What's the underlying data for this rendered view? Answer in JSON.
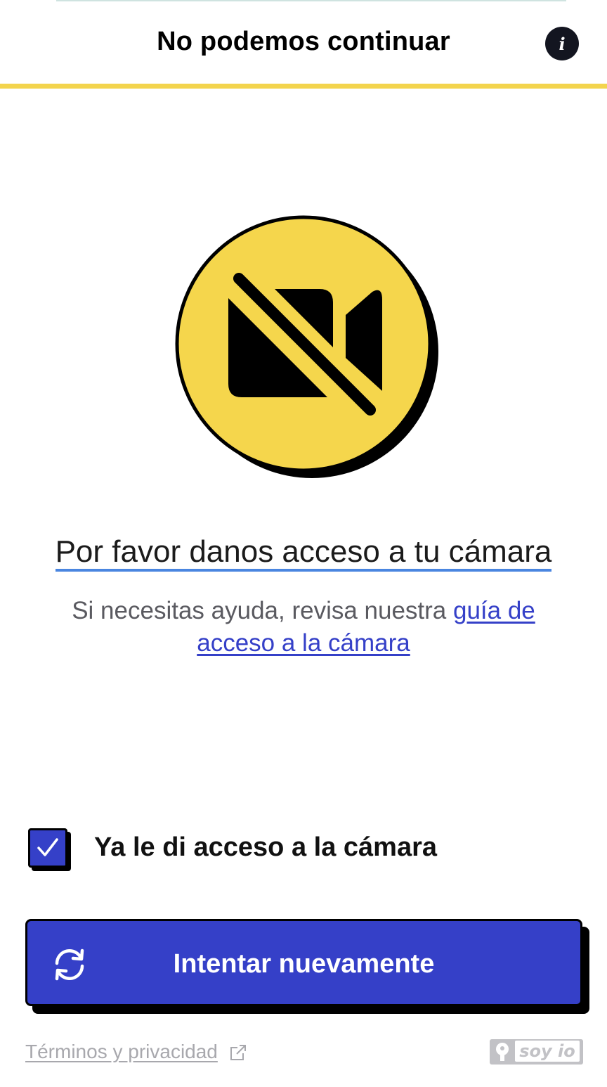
{
  "header": {
    "title": "No podemos continuar",
    "info_icon": "info-icon",
    "accent_color": "#f3d44d"
  },
  "illustration": {
    "icon": "camera-off-icon",
    "circle_color": "#f5d64c"
  },
  "main": {
    "title": "Por favor danos acceso a tu cámara",
    "help_prefix": "Si necesitas ayuda, revisa nuestra ",
    "help_link": "guía de acceso a la cámara"
  },
  "consent": {
    "label": "Ya le di acceso a la cámara",
    "checked": true
  },
  "actions": {
    "retry_label": "Intentar nuevamente",
    "retry_icon": "refresh-icon",
    "button_color": "#3540c8"
  },
  "footer": {
    "terms_label": "Términos y privacidad",
    "terms_icon": "external-link-icon",
    "brand": "soy io"
  }
}
